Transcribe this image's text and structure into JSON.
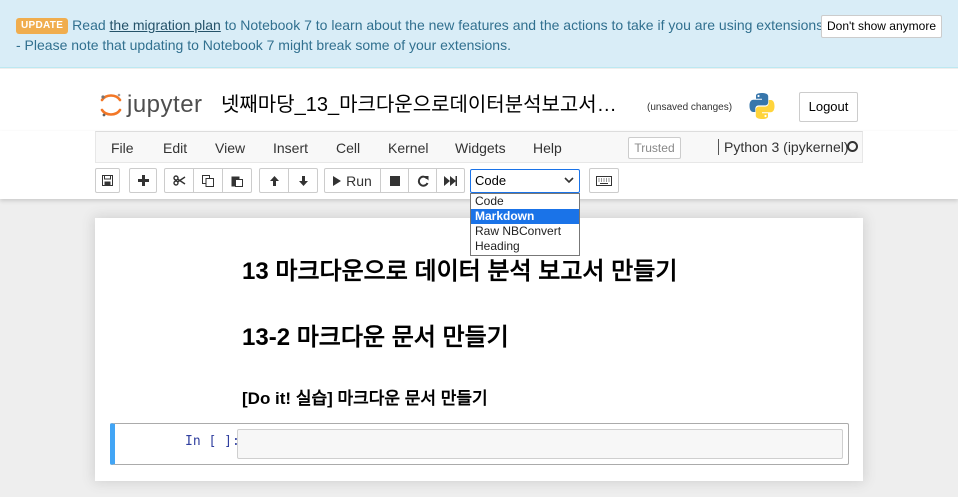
{
  "banner": {
    "badge": "UPDATE",
    "text_before": "Read ",
    "link": "the migration plan",
    "text_after": " to Notebook 7 to learn about the new features and the actions to take if you are using extensions - Please note that updating to Notebook 7 might break some of your extensions.",
    "dismiss_label": "Don't show anymore"
  },
  "header": {
    "logo_text": "jupyter",
    "notebook_title": "넷째마당_13_마크다운으로데이터분석보고서…",
    "save_status": "(unsaved changes)",
    "logout_label": "Logout"
  },
  "menu": {
    "items": [
      "File",
      "Edit",
      "View",
      "Insert",
      "Cell",
      "Kernel",
      "Widgets",
      "Help"
    ],
    "trusted_label": "Trusted",
    "kernel_name": "Python 3 (ipykernel)"
  },
  "toolbar": {
    "run_label": "Run",
    "cell_type_value": "Code",
    "cell_type_options": [
      "Code",
      "Markdown",
      "Raw NBConvert",
      "Heading"
    ],
    "highlighted_option": "Markdown"
  },
  "notebook": {
    "heading1": "13 마크다운으로 데이터 분석 보고서 만들기",
    "heading2": "13-2 마크다운 문서 만들기",
    "heading3": "[Do it! 실습] 마크다운 문서 만들기",
    "prompt": "In [ ]:"
  },
  "colors": {
    "banner_bg": "#d9edf7",
    "banner_text": "#31708f",
    "badge": "#f0ad4e",
    "logo_orange": "#f37726",
    "selection_blue": "#1a73e8",
    "cell_border": "#42a5f5"
  }
}
